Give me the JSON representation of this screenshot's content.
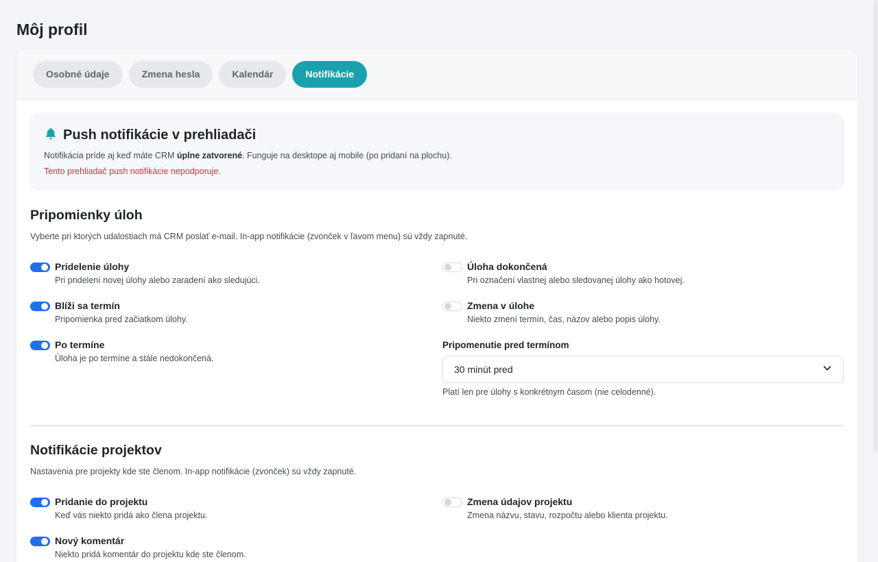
{
  "page": {
    "title": "Môj profil"
  },
  "tabs": [
    {
      "label": "Osobné údaje",
      "active": false
    },
    {
      "label": "Zmena hesla",
      "active": false
    },
    {
      "label": "Kalendár",
      "active": false
    },
    {
      "label": "Notifikácie",
      "active": true
    }
  ],
  "push": {
    "title": "Push notifikácie v prehliadači",
    "desc_pre": "Notifikácia príde aj keď máte CRM ",
    "desc_bold": "úplne zatvorené",
    "desc_post": ". Funguje na desktope aj mobile (po pridaní na plochu).",
    "warning": "Tento prehliadač push notifikácie nepodporuje.",
    "icon": "bell-icon"
  },
  "tasks": {
    "title": "Pripomienky úloh",
    "desc": "Vyberte pri ktorých udalostiach má CRM poslať e-mail. In-app notifikácie (zvonček v ľavom menu) sú vždy zapnuté.",
    "options": [
      {
        "label": "Pridelenie úlohy",
        "desc": "Pri pridelení novej úlohy alebo zaradení ako sledujúci.",
        "enabled": true
      },
      {
        "label": "Úloha dokončená",
        "desc": "Pri označení vlastnej alebo sledovanej úlohy ako hotovej.",
        "enabled": false
      },
      {
        "label": "Blíži sa termín",
        "desc": "Pripomienka pred začiatkom úlohy.",
        "enabled": true
      },
      {
        "label": "Zmena v úlohe",
        "desc": "Niekto zmení termín, čas, názov alebo popis úlohy.",
        "enabled": false
      },
      {
        "label": "Po termíne",
        "desc": "Úloha je po termíne a stále nedokončená.",
        "enabled": true
      }
    ],
    "reminder": {
      "label": "Pripomenutie pred termínom",
      "value": "30 minút pred",
      "hint": "Platí len pre úlohy s konkrétnym časom (nie celodenné)."
    }
  },
  "projects": {
    "title": "Notifikácie projektov",
    "desc": "Nastavenia pre projekty kde ste členom. In-app notifikácie (zvonček) sú vždy zapnuté.",
    "options": [
      {
        "label": "Pridanie do projektu",
        "desc": "Keď vás niekto pridá ako člena projektu.",
        "enabled": true
      },
      {
        "label": "Zmena údajov projektu",
        "desc": "Zmena názvu, stavu, rozpočtu alebo klienta projektu.",
        "enabled": false
      },
      {
        "label": "Nový komentár",
        "desc": "Niekto pridá komentár do projektu kde ste členom.",
        "enabled": true
      }
    ]
  },
  "colors": {
    "accent": "#1aa1ad",
    "toggle_on": "#1f6fec",
    "warning": "#d32f45"
  }
}
